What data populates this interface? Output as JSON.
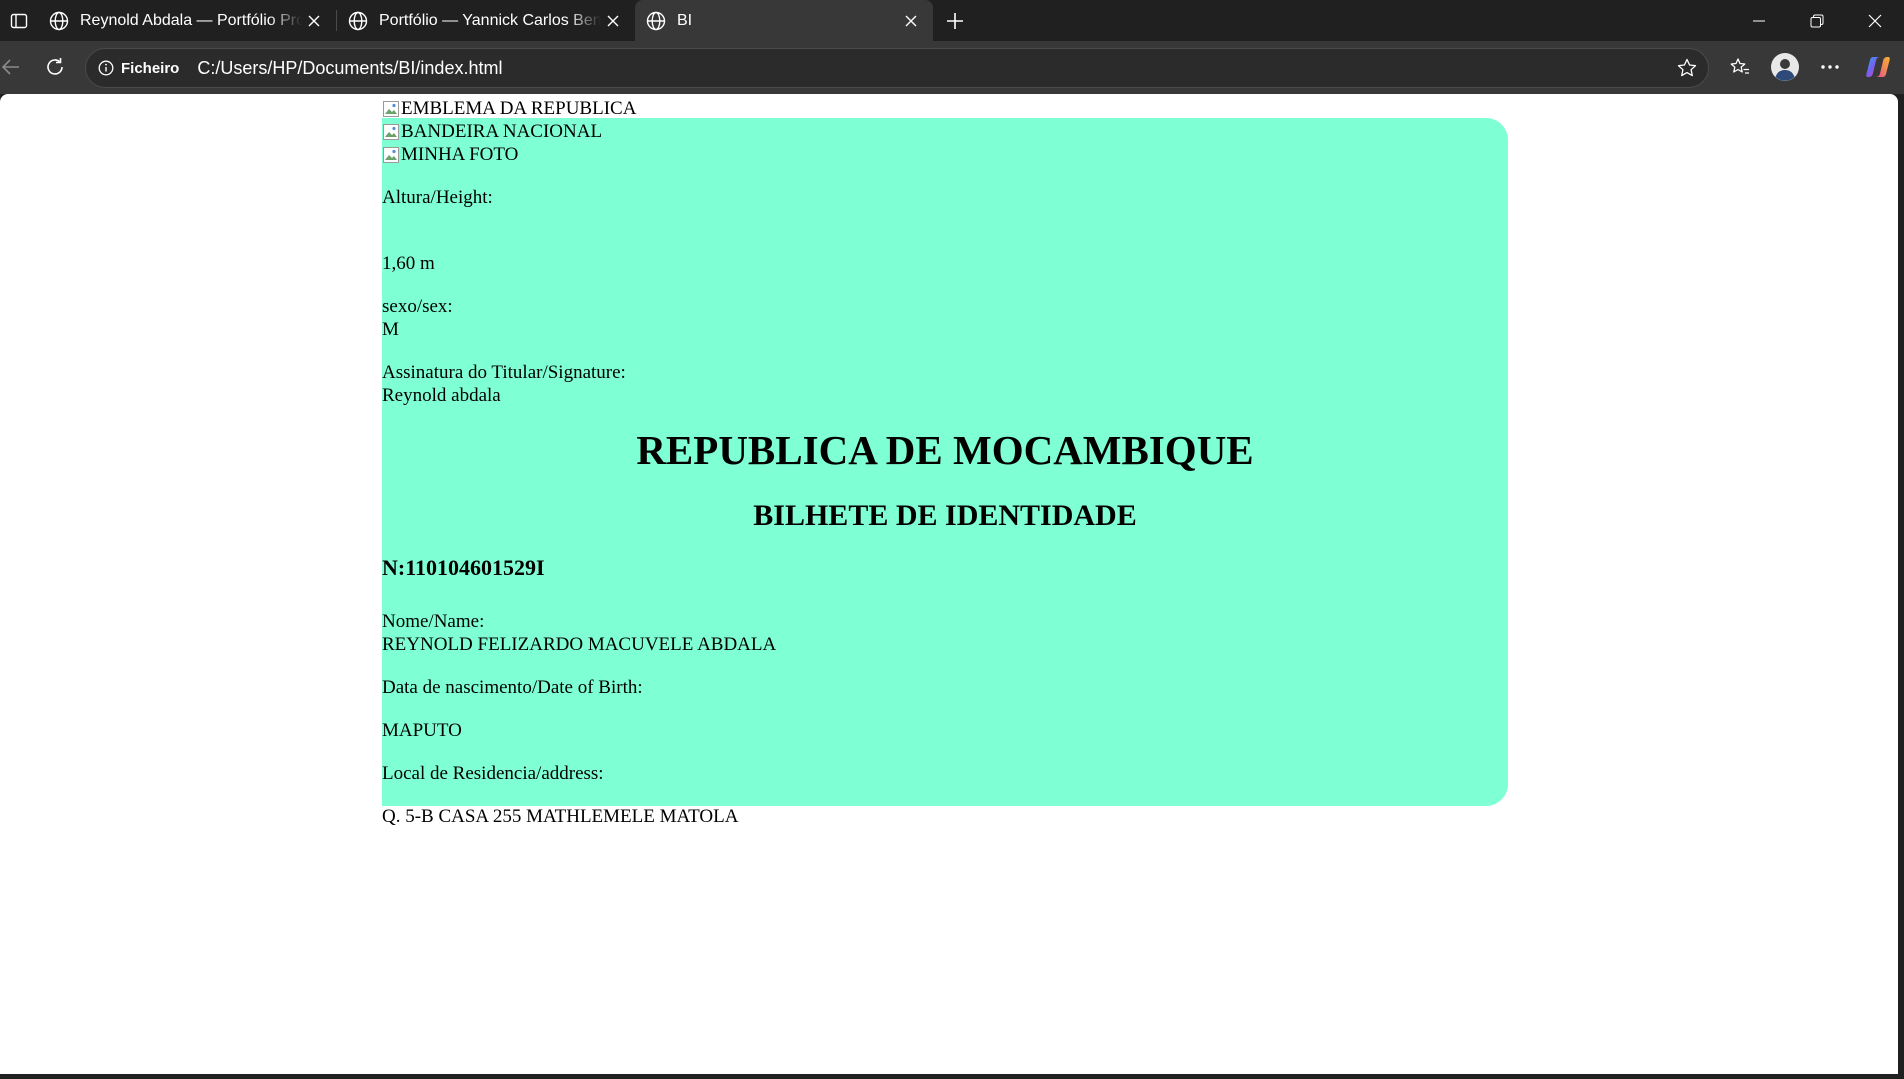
{
  "browser": {
    "tabs": [
      {
        "title": "Reynold Abdala — Portfólio Profissional",
        "active": false
      },
      {
        "title": "Portfólio — Yannick Carlos Bento",
        "active": false
      },
      {
        "title": "BI",
        "active": true
      }
    ],
    "address": {
      "site_info_label": "Ficheiro",
      "url": "C:/Users/HP/Documents/BI/index.html"
    }
  },
  "page": {
    "images": {
      "emblem_alt": "EMBLEMA DA REPUBLICA",
      "flag_alt": "BANDEIRA NACIONAL",
      "photo_alt": "MINHA FOTO"
    },
    "height_label": "Altura/Height:",
    "height_value": "1,60 m",
    "sex_label": "sexo/sex:",
    "sex_value": "M",
    "signature_label": "Assinatura do Titular/Signature:",
    "signature_value": "Reynold abdala",
    "title": "REPUBLICA DE MOCAMBIQUE",
    "subtitle": "BILHETE DE IDENTIDADE",
    "id_number": "N:110104601529I",
    "name_label": "Nome/Name:",
    "name_value": "REYNOLD FELIZARDO MACUVELE ABDALA",
    "birth_label": "Data de nascimento/Date of Birth:",
    "birth_place": "MAPUTO",
    "address_label": "Local de Residencia/address:",
    "address_value": "Q. 5-B CASA 255 MATHLEMELE MATOLA",
    "card_color": "#7fffd4"
  }
}
